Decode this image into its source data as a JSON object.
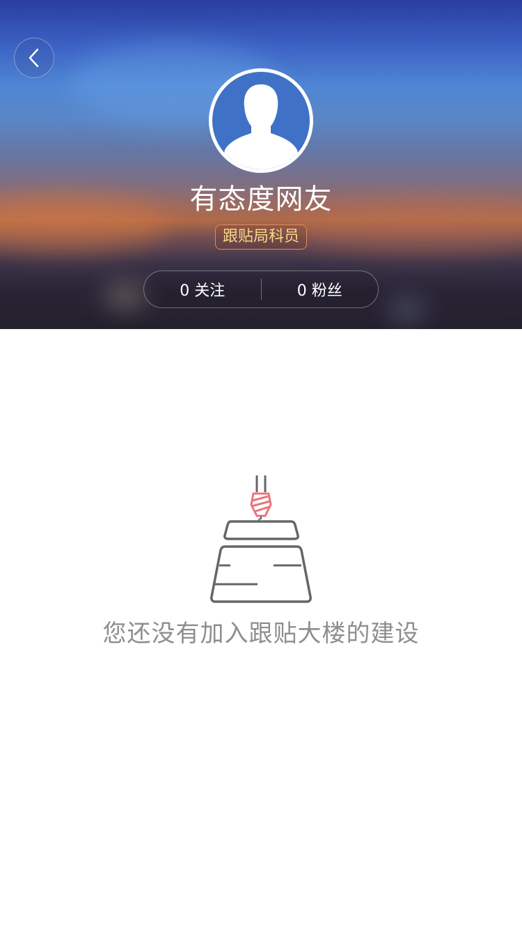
{
  "header": {
    "back_icon": "chevron-left-icon",
    "avatar_icon": "default-user-silhouette-icon",
    "nickname": "有态度网友",
    "badge": "跟贴局科员",
    "following": "0 关注",
    "followers": "0 粉丝"
  },
  "empty_state": {
    "illustration": "crane-building-icon",
    "message": "您还没有加入跟贴大楼的建设"
  },
  "colors": {
    "badge_text": "#f7d68a",
    "badge_border": "#d98e64",
    "empty_text": "#8e8e8e",
    "illustration_stroke": "#666666",
    "hook_accent": "#e8757a"
  }
}
